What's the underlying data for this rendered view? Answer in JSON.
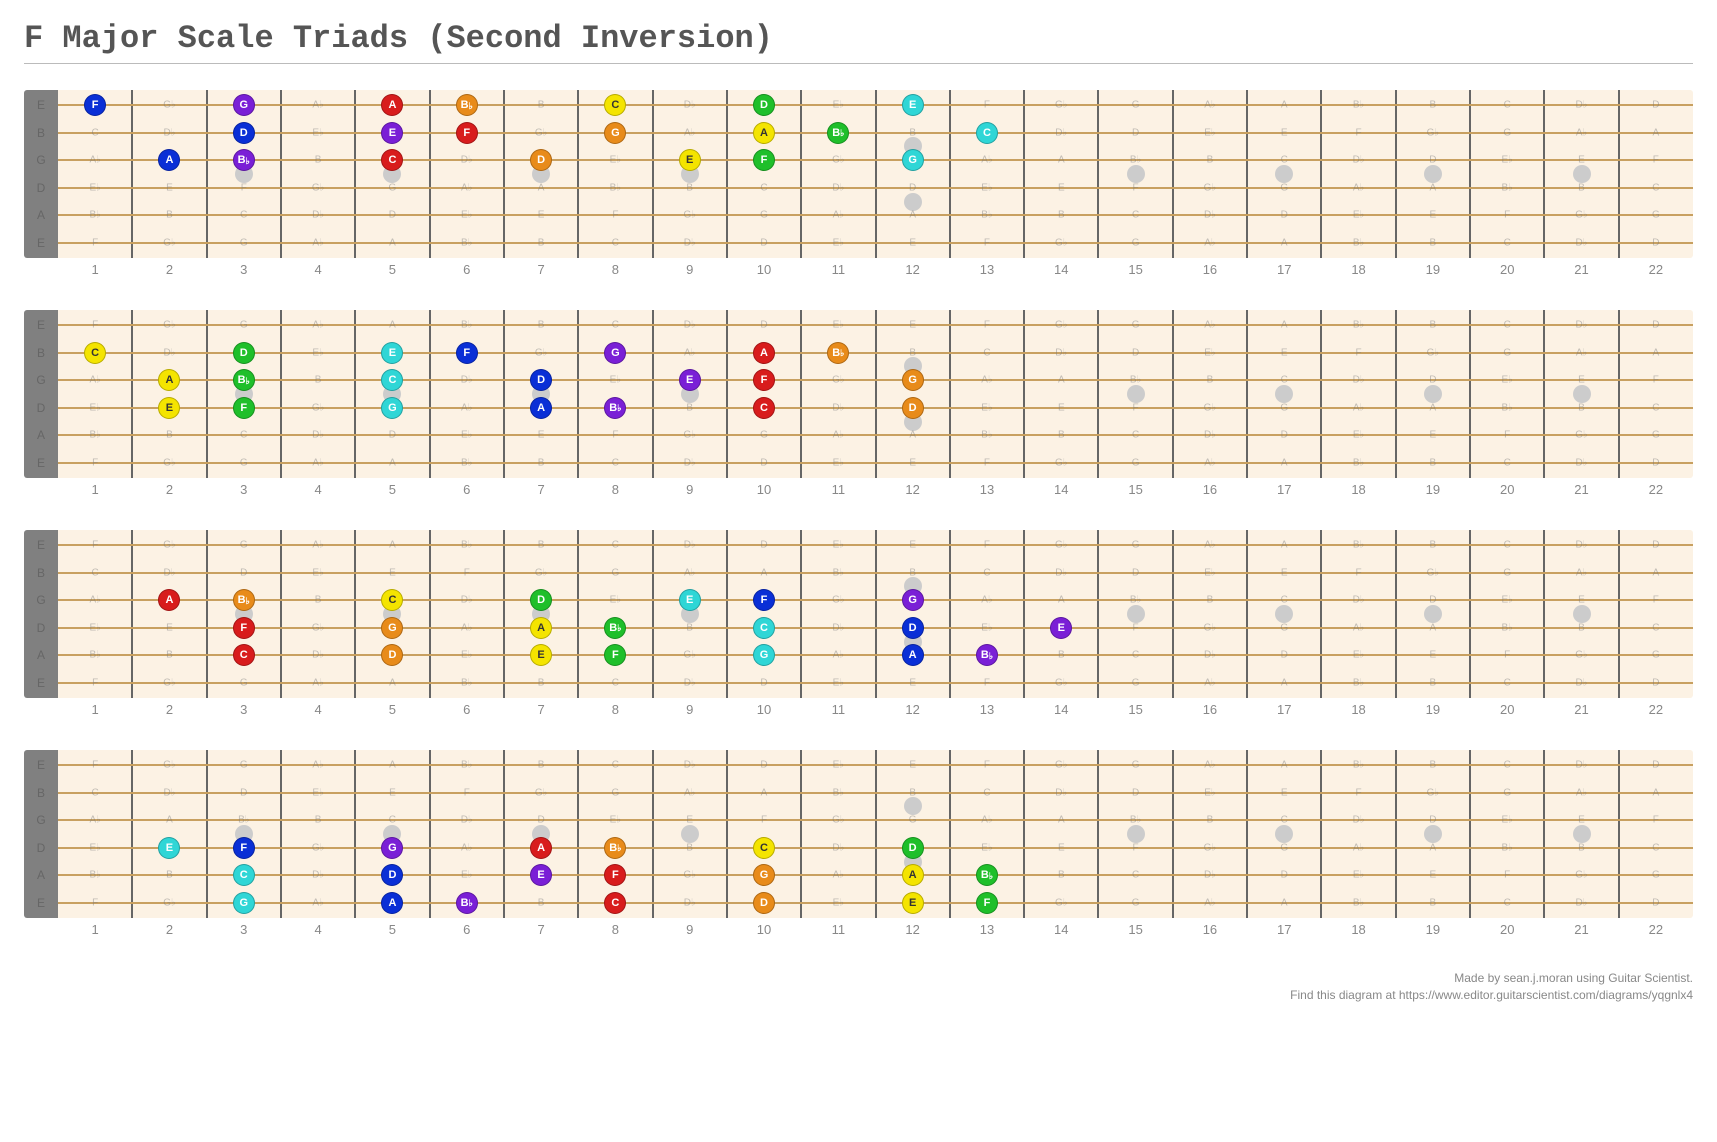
{
  "title": "F Major Scale Triads (Second Inversion)",
  "frets": 22,
  "inlay_frets_single": [
    3,
    5,
    7,
    9,
    15,
    17,
    19,
    21
  ],
  "inlay_frets_double": [
    12
  ],
  "tuning_labels": [
    "E",
    "B",
    "G",
    "D",
    "A",
    "E"
  ],
  "ghost_base": [
    "E",
    "B",
    "G",
    "D",
    "A",
    "E"
  ],
  "sharp_order": [
    "C",
    "C#",
    "D",
    "D#",
    "E",
    "F",
    "F#",
    "G",
    "G#",
    "A",
    "A#",
    "B"
  ],
  "flat_of_sharp": {
    "C#": "D♭",
    "D#": "E♭",
    "F#": "G♭",
    "G#": "A♭",
    "A#": "B♭"
  },
  "colors": {
    "darkblue": "#0a2fd6",
    "purple": "#7a1fd6",
    "red": "#d81c1c",
    "orange": "#e88b1a",
    "yellow": "#f4e400",
    "green": "#1fbf2a",
    "cyan": "#2fd6d6"
  },
  "text_dark": [
    "yellow"
  ],
  "boards": [
    {
      "name": "board-1",
      "dots": [
        {
          "s": 0,
          "f": 1,
          "n": "F",
          "c": "darkblue"
        },
        {
          "s": 0,
          "f": 3,
          "n": "G",
          "c": "purple"
        },
        {
          "s": 0,
          "f": 5,
          "n": "A",
          "c": "red"
        },
        {
          "s": 0,
          "f": 6,
          "n": "B♭",
          "c": "orange"
        },
        {
          "s": 0,
          "f": 8,
          "n": "C",
          "c": "yellow"
        },
        {
          "s": 0,
          "f": 10,
          "n": "D",
          "c": "green"
        },
        {
          "s": 0,
          "f": 12,
          "n": "E",
          "c": "cyan"
        },
        {
          "s": 1,
          "f": 3,
          "n": "D",
          "c": "darkblue"
        },
        {
          "s": 1,
          "f": 5,
          "n": "E",
          "c": "purple"
        },
        {
          "s": 1,
          "f": 6,
          "n": "F",
          "c": "red"
        },
        {
          "s": 1,
          "f": 8,
          "n": "G",
          "c": "orange"
        },
        {
          "s": 1,
          "f": 10,
          "n": "A",
          "c": "yellow"
        },
        {
          "s": 1,
          "f": 11,
          "n": "B♭",
          "c": "green"
        },
        {
          "s": 1,
          "f": 13,
          "n": "C",
          "c": "cyan"
        },
        {
          "s": 2,
          "f": 2,
          "n": "A",
          "c": "darkblue"
        },
        {
          "s": 2,
          "f": 3,
          "n": "B♭",
          "c": "purple"
        },
        {
          "s": 2,
          "f": 5,
          "n": "C",
          "c": "red"
        },
        {
          "s": 2,
          "f": 7,
          "n": "D",
          "c": "orange"
        },
        {
          "s": 2,
          "f": 9,
          "n": "E",
          "c": "yellow"
        },
        {
          "s": 2,
          "f": 10,
          "n": "F",
          "c": "green"
        },
        {
          "s": 2,
          "f": 12,
          "n": "G",
          "c": "cyan"
        }
      ]
    },
    {
      "name": "board-2",
      "dots": [
        {
          "s": 1,
          "f": 1,
          "n": "C",
          "c": "yellow"
        },
        {
          "s": 1,
          "f": 3,
          "n": "D",
          "c": "green"
        },
        {
          "s": 1,
          "f": 5,
          "n": "E",
          "c": "cyan"
        },
        {
          "s": 1,
          "f": 6,
          "n": "F",
          "c": "darkblue"
        },
        {
          "s": 1,
          "f": 8,
          "n": "G",
          "c": "purple"
        },
        {
          "s": 1,
          "f": 10,
          "n": "A",
          "c": "red"
        },
        {
          "s": 1,
          "f": 11,
          "n": "B♭",
          "c": "orange"
        },
        {
          "s": 2,
          "f": 2,
          "n": "A",
          "c": "yellow"
        },
        {
          "s": 2,
          "f": 3,
          "n": "B♭",
          "c": "green"
        },
        {
          "s": 2,
          "f": 5,
          "n": "C",
          "c": "cyan"
        },
        {
          "s": 2,
          "f": 7,
          "n": "D",
          "c": "darkblue"
        },
        {
          "s": 2,
          "f": 9,
          "n": "E",
          "c": "purple"
        },
        {
          "s": 2,
          "f": 10,
          "n": "F",
          "c": "red"
        },
        {
          "s": 2,
          "f": 12,
          "n": "G",
          "c": "orange"
        },
        {
          "s": 3,
          "f": 2,
          "n": "E",
          "c": "yellow"
        },
        {
          "s": 3,
          "f": 3,
          "n": "F",
          "c": "green"
        },
        {
          "s": 3,
          "f": 5,
          "n": "G",
          "c": "cyan"
        },
        {
          "s": 3,
          "f": 7,
          "n": "A",
          "c": "darkblue"
        },
        {
          "s": 3,
          "f": 8,
          "n": "B♭",
          "c": "purple"
        },
        {
          "s": 3,
          "f": 10,
          "n": "C",
          "c": "red"
        },
        {
          "s": 3,
          "f": 12,
          "n": "D",
          "c": "orange"
        }
      ]
    },
    {
      "name": "board-3",
      "dots": [
        {
          "s": 2,
          "f": 2,
          "n": "A",
          "c": "red"
        },
        {
          "s": 2,
          "f": 3,
          "n": "B♭",
          "c": "orange"
        },
        {
          "s": 2,
          "f": 5,
          "n": "C",
          "c": "yellow"
        },
        {
          "s": 2,
          "f": 7,
          "n": "D",
          "c": "green"
        },
        {
          "s": 2,
          "f": 9,
          "n": "E",
          "c": "cyan"
        },
        {
          "s": 2,
          "f": 10,
          "n": "F",
          "c": "darkblue"
        },
        {
          "s": 2,
          "f": 12,
          "n": "G",
          "c": "purple"
        },
        {
          "s": 3,
          "f": 3,
          "n": "F",
          "c": "red"
        },
        {
          "s": 3,
          "f": 5,
          "n": "G",
          "c": "orange"
        },
        {
          "s": 3,
          "f": 7,
          "n": "A",
          "c": "yellow"
        },
        {
          "s": 3,
          "f": 8,
          "n": "B♭",
          "c": "green"
        },
        {
          "s": 3,
          "f": 10,
          "n": "C",
          "c": "cyan"
        },
        {
          "s": 3,
          "f": 12,
          "n": "D",
          "c": "darkblue"
        },
        {
          "s": 3,
          "f": 14,
          "n": "E",
          "c": "purple"
        },
        {
          "s": 4,
          "f": 3,
          "n": "C",
          "c": "red"
        },
        {
          "s": 4,
          "f": 5,
          "n": "D",
          "c": "orange"
        },
        {
          "s": 4,
          "f": 7,
          "n": "E",
          "c": "yellow"
        },
        {
          "s": 4,
          "f": 8,
          "n": "F",
          "c": "green"
        },
        {
          "s": 4,
          "f": 10,
          "n": "G",
          "c": "cyan"
        },
        {
          "s": 4,
          "f": 12,
          "n": "A",
          "c": "darkblue"
        },
        {
          "s": 4,
          "f": 13,
          "n": "B♭",
          "c": "purple"
        }
      ]
    },
    {
      "name": "board-4",
      "dots": [
        {
          "s": 3,
          "f": 2,
          "n": "E",
          "c": "cyan"
        },
        {
          "s": 3,
          "f": 3,
          "n": "F",
          "c": "darkblue"
        },
        {
          "s": 3,
          "f": 5,
          "n": "G",
          "c": "purple"
        },
        {
          "s": 3,
          "f": 7,
          "n": "A",
          "c": "red"
        },
        {
          "s": 3,
          "f": 8,
          "n": "B♭",
          "c": "orange"
        },
        {
          "s": 3,
          "f": 10,
          "n": "C",
          "c": "yellow"
        },
        {
          "s": 3,
          "f": 12,
          "n": "D",
          "c": "green"
        },
        {
          "s": 4,
          "f": 3,
          "n": "C",
          "c": "cyan"
        },
        {
          "s": 4,
          "f": 5,
          "n": "D",
          "c": "darkblue"
        },
        {
          "s": 4,
          "f": 7,
          "n": "E",
          "c": "purple"
        },
        {
          "s": 4,
          "f": 8,
          "n": "F",
          "c": "red"
        },
        {
          "s": 4,
          "f": 10,
          "n": "G",
          "c": "orange"
        },
        {
          "s": 4,
          "f": 12,
          "n": "A",
          "c": "yellow"
        },
        {
          "s": 4,
          "f": 13,
          "n": "B♭",
          "c": "green"
        },
        {
          "s": 5,
          "f": 3,
          "n": "G",
          "c": "cyan"
        },
        {
          "s": 5,
          "f": 5,
          "n": "A",
          "c": "darkblue"
        },
        {
          "s": 5,
          "f": 6,
          "n": "B♭",
          "c": "purple"
        },
        {
          "s": 5,
          "f": 8,
          "n": "C",
          "c": "red"
        },
        {
          "s": 5,
          "f": 10,
          "n": "D",
          "c": "orange"
        },
        {
          "s": 5,
          "f": 12,
          "n": "E",
          "c": "yellow"
        },
        {
          "s": 5,
          "f": 13,
          "n": "F",
          "c": "green"
        }
      ]
    }
  ],
  "footer": {
    "line1": "Made by sean.j.moran using Guitar Scientist.",
    "line2": "Find this diagram at https://www.editor.guitarscientist.com/diagrams/yqgnlx4"
  }
}
